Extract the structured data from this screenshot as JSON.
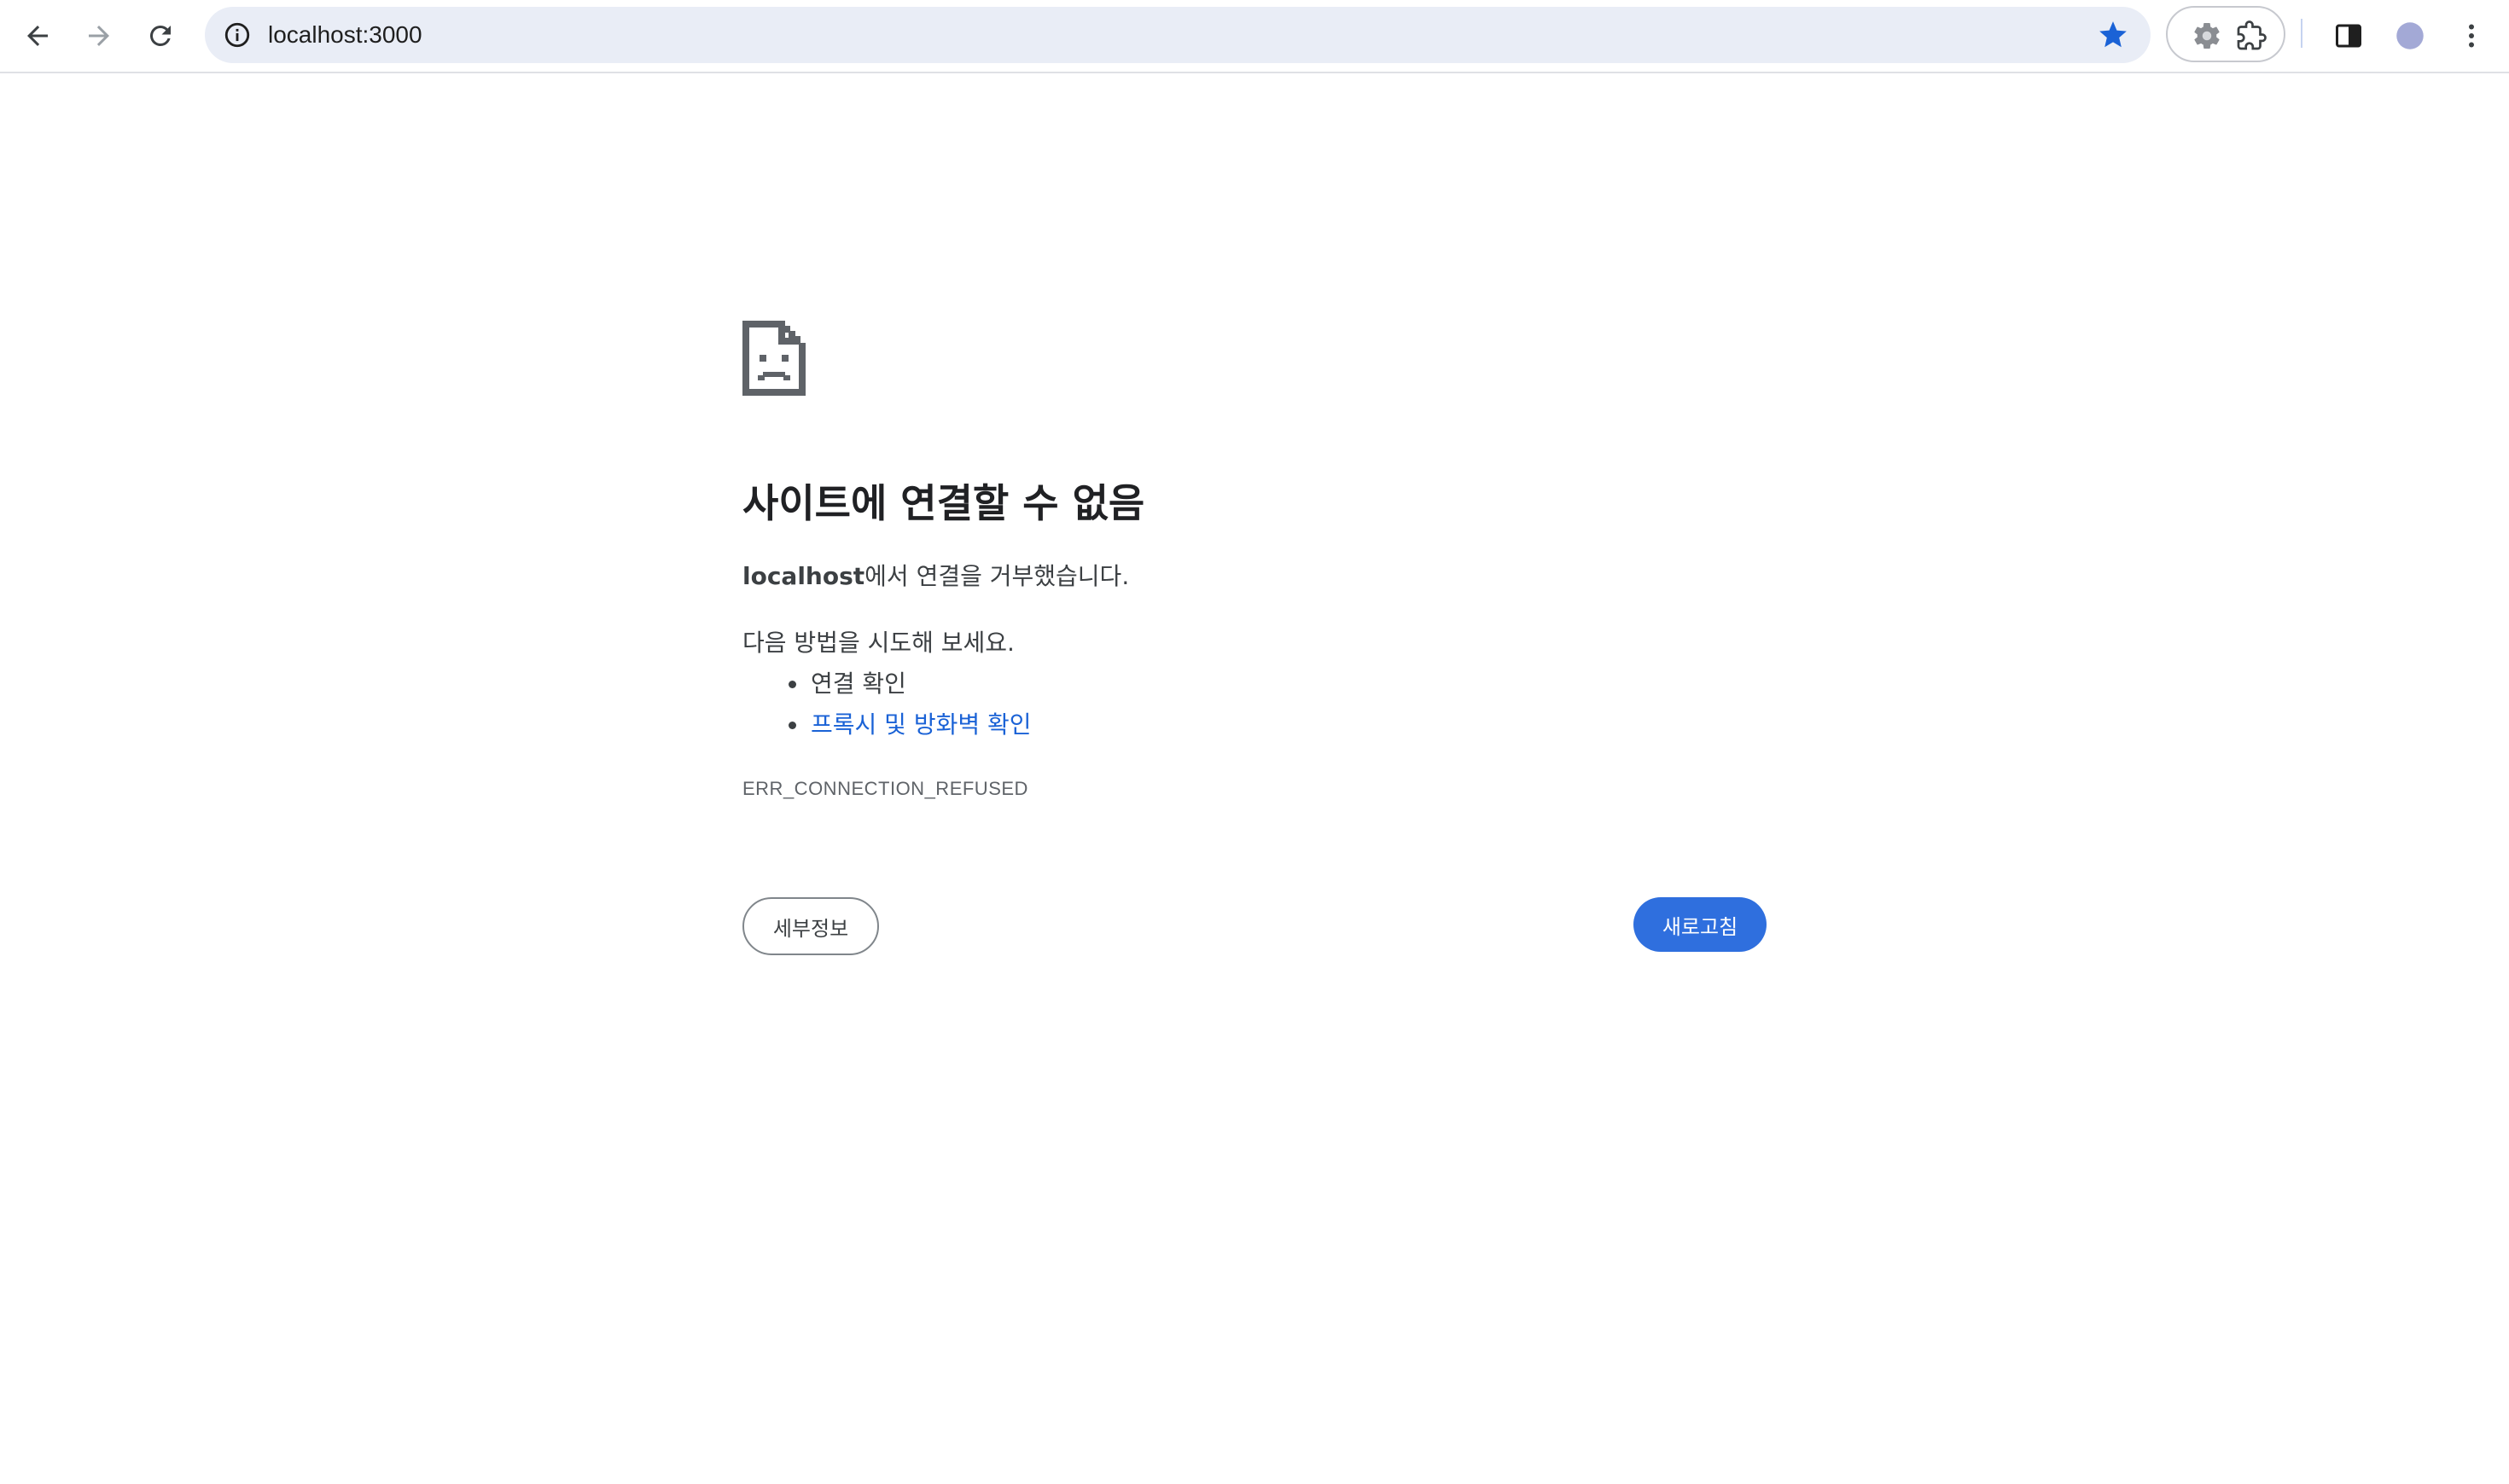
{
  "browser": {
    "url": "localhost:3000",
    "bookmarked": true,
    "colors": {
      "star": "#1a62d6",
      "omnibox_bg": "#e9edf6",
      "avatar": "#a3a9d6"
    },
    "icons": [
      "back-arrow-icon",
      "forward-arrow-icon",
      "reload-icon",
      "info-icon",
      "star-icon",
      "gear-extension-icon",
      "puzzle-extension-icon",
      "side-panel-icon",
      "profile-avatar-icon",
      "more-vert-icon"
    ]
  },
  "error_page": {
    "title": "사이트에 연결할 수 없음",
    "host": "localhost",
    "description_suffix": "에서 연결을 거부했습니다.",
    "suggestions_heading": "다음 방법을 시도해 보세요.",
    "suggestions": [
      {
        "label": "연결 확인",
        "is_link": false
      },
      {
        "label": "프록시 및 방화벽 확인",
        "is_link": true
      }
    ],
    "error_code": "ERR_CONNECTION_REFUSED",
    "details_button": "세부정보",
    "reload_button": "새로고침",
    "colors": {
      "reload_button_bg": "#2f6fde",
      "link": "#1a62d6"
    }
  }
}
